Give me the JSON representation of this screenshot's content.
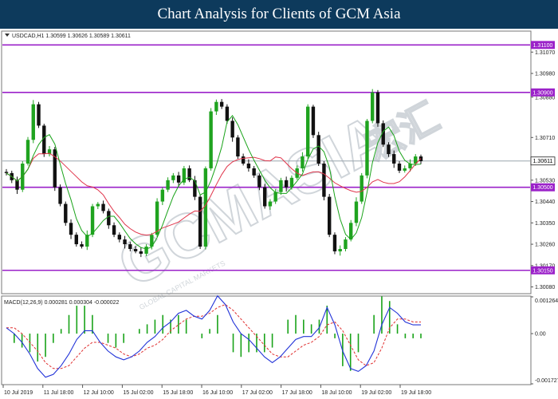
{
  "page_title": "Chart Analysis for Clients of GCM Asia",
  "watermark_text": "GCMASIA",
  "watermark_cn": "宏汇",
  "watermark_tagline": "GLOBAL CAPITAL MARKETS",
  "colors": {
    "banner": "#0d3a5c",
    "up_candle": "#1fa31f",
    "down_candle": "#111111",
    "level_line": "#9b22c9",
    "ma_fast": "#19a319",
    "ma_slow": "#e0344a",
    "current_price_line": "#9aa5ad",
    "macd_line": "#2233d8",
    "signal_line": "#e03030",
    "histogram": "#19a319"
  },
  "chart_data": [
    {
      "type": "candlestick",
      "title": "USDCAD,H1 1.30599 1.30626 1.30589 1.30611",
      "symbol": "USDCAD",
      "timeframe": "H1",
      "ohlc_last": {
        "open": 1.30599,
        "high": 1.30626,
        "low": 1.30589,
        "close": 1.30611
      },
      "ylim": [
        1.30055,
        1.31155
      ],
      "y_ticks": [
        1.3107,
        1.3098,
        1.3088,
        1.3071,
        1.3053,
        1.3044,
        1.3035,
        1.3026,
        1.3017,
        1.3008
      ],
      "y_tick_labels": [
        "1.31070",
        "1.30980",
        "1.30880",
        "1.30710",
        "1.30530",
        "1.30440",
        "1.30350",
        "1.30260",
        "1.30170",
        "1.30080"
      ],
      "x_tick_labels": [
        "10 Jul 2019",
        "11 Jul 18:00",
        "12 Jul 10:00",
        "15 Jul 02:00",
        "15 Jul 18:00",
        "16 Jul 10:00",
        "17 Jul 02:00",
        "17 Jul 18:00",
        "18 Jul 10:00",
        "19 Jul 02:00",
        "19 Jul 18:00"
      ],
      "horizontal_levels": [
        {
          "value": 1.311,
          "label": "1.31100"
        },
        {
          "value": 1.309,
          "label": "1.30900"
        },
        {
          "value": 1.305,
          "label": "1.30500"
        },
        {
          "value": 1.3015,
          "label": "1.30150"
        }
      ],
      "current_price": {
        "value": 1.30611,
        "label": "1.30611"
      },
      "close_series": [
        1.3056,
        1.3053,
        1.3049,
        1.306,
        1.307,
        1.3085,
        1.3076,
        1.3064,
        1.3066,
        1.305,
        1.3043,
        1.3035,
        1.303,
        1.3026,
        1.3025,
        1.303,
        1.3042,
        1.3043,
        1.304,
        1.3034,
        1.303,
        1.3028,
        1.3026,
        1.3024,
        1.3023,
        1.3022,
        1.3025,
        1.303,
        1.3044,
        1.3049,
        1.3053,
        1.3055,
        1.3052,
        1.3058,
        1.3053,
        1.3046,
        1.3025,
        1.3058,
        1.3082,
        1.3086,
        1.3084,
        1.3078,
        1.3071,
        1.3063,
        1.306,
        1.3058,
        1.3055,
        1.305,
        1.3042,
        1.3044,
        1.3048,
        1.3053,
        1.305,
        1.3054,
        1.3058,
        1.3063,
        1.3084,
        1.3072,
        1.306,
        1.3046,
        1.303,
        1.3023,
        1.3024,
        1.3028,
        1.3035,
        1.3044,
        1.3055,
        1.3078,
        1.309,
        1.3077,
        1.3068,
        1.3064,
        1.306,
        1.3057,
        1.3058,
        1.306,
        1.3063,
        1.3061
      ]
    },
    {
      "type": "line",
      "title": "MACD(12,26,9) 0.000281 0.000304 -0.000022",
      "indicator": "MACD(12,26,9)",
      "values_shown": [
        0.000281,
        0.000304,
        -2.2e-05
      ],
      "y_tick_labels": [
        "0.001264",
        "0.00",
        "-0.001727"
      ],
      "ylim": [
        -0.001727,
        0.001264
      ],
      "series": [
        {
          "name": "MACD",
          "values": [
            0.0002,
            0.0,
            -0.0003,
            -0.0007,
            -0.0012,
            -0.0015,
            -0.0014,
            -0.0011,
            -0.0007,
            -0.0002,
            0.0001,
            0.0001,
            -0.0003,
            -0.0006,
            -0.0008,
            -0.0009,
            -0.0008,
            -0.0006,
            -0.0003,
            -0.0001,
            0.0002,
            0.0004,
            0.0007,
            0.0008,
            0.0006,
            0.0005,
            0.0008,
            0.0013,
            0.001,
            0.0004,
            0.0,
            -0.0002,
            -0.0005,
            -0.0008,
            -0.001,
            -0.0008,
            -0.0005,
            -0.0002,
            -0.0001,
            -0.0001,
            0.0002,
            0.0009,
            0.0003,
            -0.0006,
            -0.0012,
            -0.0013,
            -0.0011,
            -0.0006,
            0.0003,
            0.0009,
            0.0007,
            0.0004,
            0.0003,
            0.0003
          ]
        },
        {
          "name": "Signal",
          "values": [
            0.0002,
            0.0002,
            0.0,
            -0.0003,
            -0.0006,
            -0.001,
            -0.0012,
            -0.0012,
            -0.0011,
            -0.0008,
            -0.0005,
            -0.0003,
            -0.0003,
            -0.0004,
            -0.0005,
            -0.0007,
            -0.0008,
            -0.0007,
            -0.0005,
            -0.0004,
            -0.0002,
            0.0001,
            0.0003,
            0.0005,
            0.0006,
            0.0006,
            0.0007,
            0.0009,
            0.001,
            0.0008,
            0.0005,
            0.0002,
            -0.0001,
            -0.0004,
            -0.0007,
            -0.0008,
            -0.0008,
            -0.0006,
            -0.0004,
            -0.0003,
            -0.0001,
            0.0003,
            0.0004,
            0.0001,
            -0.0004,
            -0.0009,
            -0.0011,
            -0.001,
            -0.0005,
            0.0002,
            0.0005,
            0.0005,
            0.0004,
            0.0004
          ]
        }
      ]
    }
  ]
}
